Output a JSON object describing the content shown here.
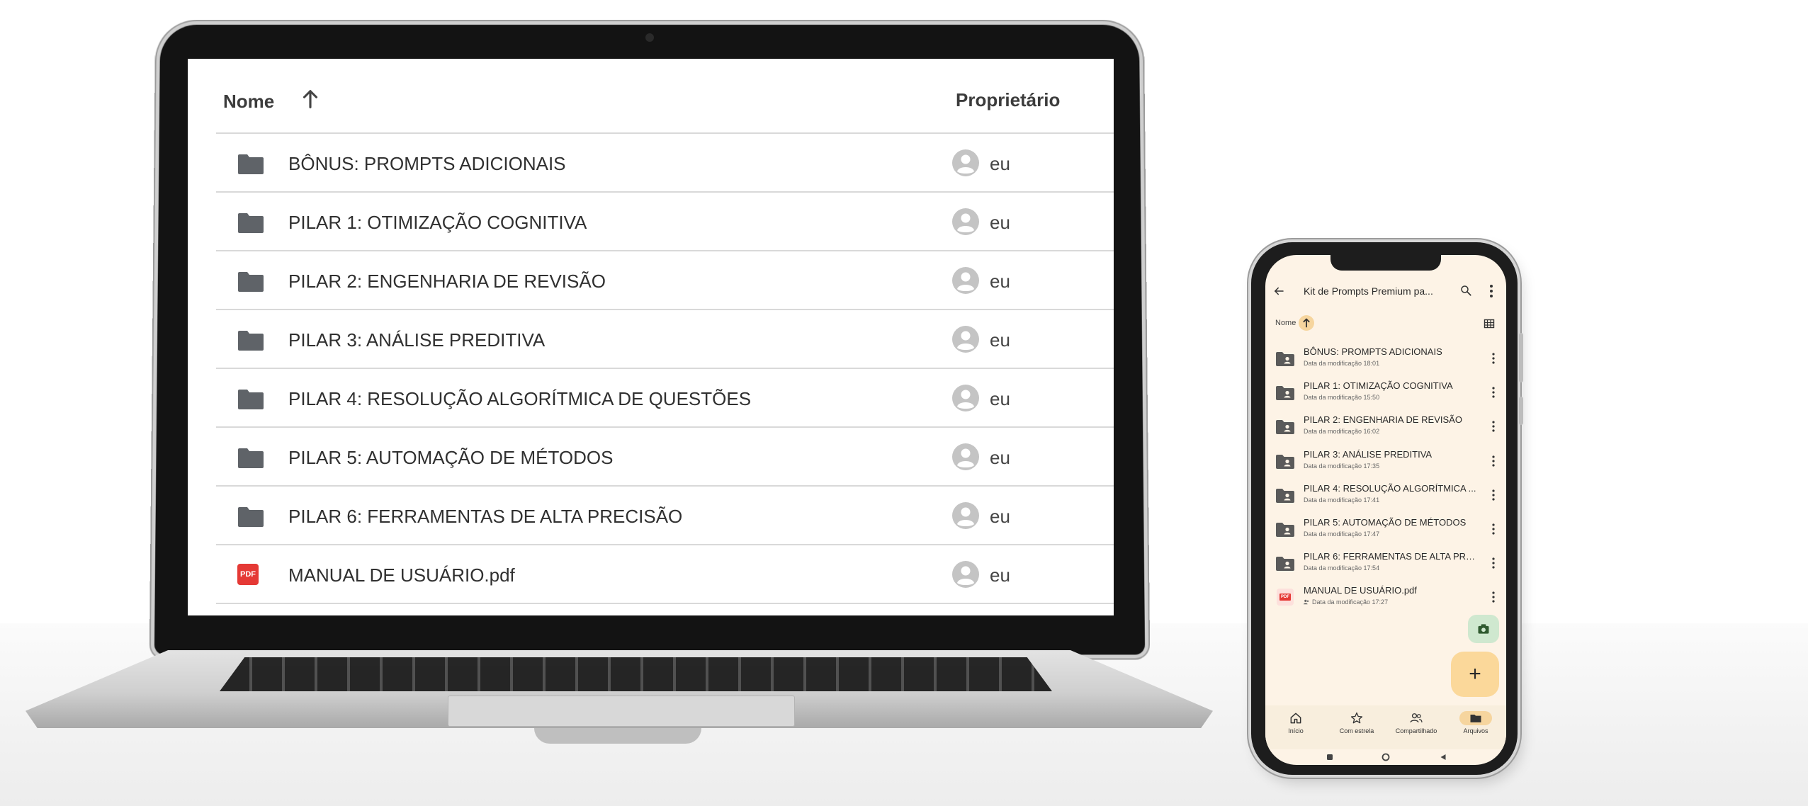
{
  "laptop": {
    "header": {
      "name_label": "Nome",
      "owner_label": "Proprietário",
      "sort_icon": "arrow-up-icon"
    },
    "rows": [
      {
        "name": "BÔNUS: PROMPTS ADICIONAIS",
        "type": "folder",
        "owner": "eu"
      },
      {
        "name": "PILAR 1: OTIMIZAÇÃO COGNITIVA",
        "type": "folder",
        "owner": "eu"
      },
      {
        "name": "PILAR 2: ENGENHARIA DE REVISÃO",
        "type": "folder",
        "owner": "eu"
      },
      {
        "name": "PILAR 3: ANÁLISE PREDITIVA",
        "type": "folder",
        "owner": "eu"
      },
      {
        "name": "PILAR 4: RESOLUÇÃO ALGORÍTMICA DE QUESTÕES",
        "type": "folder",
        "owner": "eu"
      },
      {
        "name": "PILAR 5: AUTOMAÇÃO DE MÉTODOS",
        "type": "folder",
        "owner": "eu"
      },
      {
        "name": "PILAR 6: FERRAMENTAS DE ALTA PRECISÃO",
        "type": "folder",
        "owner": "eu"
      },
      {
        "name": "MANUAL DE USUÁRIO.pdf",
        "type": "pdf",
        "pdf_badge": "PDF",
        "owner": "eu"
      }
    ]
  },
  "phone": {
    "appbar": {
      "title": "Kit de Prompts Premium pa...",
      "back_icon": "arrow-left-icon",
      "search_icon": "search-icon",
      "more_icon": "more-vertical-icon"
    },
    "sortbar": {
      "label": "Nome",
      "sort_icon": "arrow-up-icon",
      "view_icon": "grid-view-icon"
    },
    "rows": [
      {
        "name": "BÔNUS: PROMPTS ADICIONAIS",
        "date": "Data da modificação 18:01",
        "type": "shared-folder"
      },
      {
        "name": "PILAR 1: OTIMIZAÇÃO COGNITIVA",
        "date": "Data da modificação 15:50",
        "type": "shared-folder"
      },
      {
        "name": "PILAR 2: ENGENHARIA DE REVISÃO",
        "date": "Data da modificação 16:02",
        "type": "shared-folder"
      },
      {
        "name": "PILAR 3: ANÁLISE PREDITIVA",
        "date": "Data da modificação 17:35",
        "type": "shared-folder"
      },
      {
        "name": "PILAR 4: RESOLUÇÃO ALGORÍTMICA ...",
        "date": "Data da modificação 17:41",
        "type": "shared-folder"
      },
      {
        "name": "PILAR 5: AUTOMAÇÃO DE MÉTODOS",
        "date": "Data da modificação 17:47",
        "type": "shared-folder"
      },
      {
        "name": "PILAR 6: FERRAMENTAS DE ALTA PRE...",
        "date": "Data da modificação 17:54",
        "type": "shared-folder"
      },
      {
        "name": "MANUAL DE USUÁRIO.pdf",
        "date": "Data da modificação 17:27",
        "type": "pdf",
        "pdf_badge": "PDF"
      }
    ],
    "fab": {
      "camera_icon": "camera-icon",
      "add_label": "+"
    },
    "bottom_nav": [
      {
        "label": "Início",
        "icon": "home-icon"
      },
      {
        "label": "Com estrela",
        "icon": "star-icon"
      },
      {
        "label": "Compartilhado",
        "icon": "people-icon"
      },
      {
        "label": "Arquivos",
        "icon": "folder-icon",
        "active": true
      }
    ],
    "colors": {
      "background": "#fdf3e6",
      "accent": "#f6d59e",
      "fab_add": "#fbd89a",
      "fab_camera": "#cfe8cf",
      "pdf_red": "#e53935"
    }
  }
}
